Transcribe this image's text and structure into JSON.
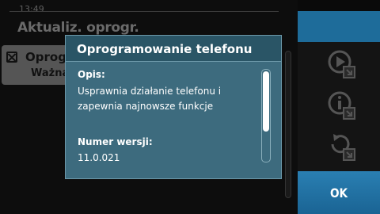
{
  "status": {
    "time": "13:49"
  },
  "app": {
    "title": "Aktualiz. oprogr."
  },
  "list": {
    "item_name": "Oprog",
    "item_sub": "Ważna"
  },
  "toolbar": {
    "ok_label": "OK",
    "buttons": [
      "play-info-icon",
      "info-details-icon",
      "update-refresh-icon"
    ]
  },
  "dialog": {
    "title": "Oprogramowanie telefonu",
    "description_label": "Opis:",
    "description_line1": "Usprawnia działanie telefonu i",
    "description_line2": "zapewnia najnowsze funkcje",
    "version_label": "Numer wersji:",
    "version_value": "11.0.021"
  },
  "colors": {
    "accent": "#1e6c9a",
    "dialog_bg": "#3d6b7e",
    "dialog_header": "#2a5566"
  }
}
